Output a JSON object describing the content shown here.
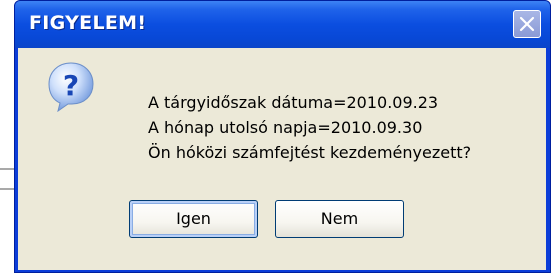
{
  "dialog": {
    "title": "FIGYELEM!",
    "close_icon": "close-icon",
    "message_lines": [
      "A tárgyidőszak dátuma=2010.09.23",
      "A hónap utolsó napja=2010.09.30",
      "Ön hóközi számfejtést kezdeményezett?"
    ],
    "icon": "question-icon",
    "buttons": {
      "yes_label": "Igen",
      "no_label": "Nem"
    }
  },
  "colors": {
    "titlebar": "#0b4ee0",
    "client": "#ece9d8",
    "button_border": "#003c74"
  }
}
